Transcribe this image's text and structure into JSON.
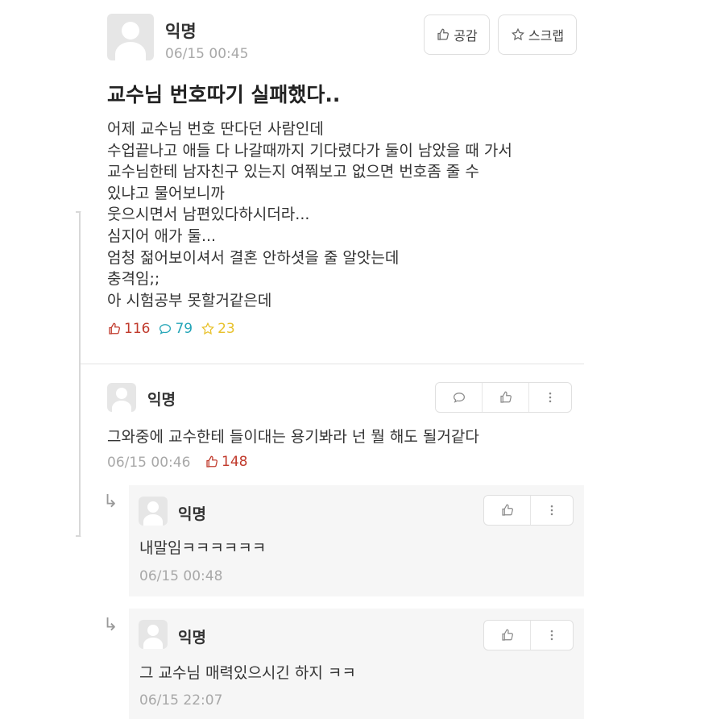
{
  "post": {
    "author": "익명",
    "time": "06/15 00:45",
    "like_label": "공감",
    "scrap_label": "스크랩",
    "title": "교수님 번호따기 실패했다..",
    "lines": [
      "어제 교수님 번호 딴다던 사람인데",
      "수업끝나고 애들 다 나갈때까지 기다렸다가 둘이 남았을 때 가서",
      "교수님한테 남자친구 있는지 여쭤보고 없으면 번호좀 줄 수",
      "있냐고 물어보니까",
      "웃으시면서 남편있다하시더라...",
      "심지어 애가 둘...",
      "엄청 젊어보이셔서 결혼 안하셧을 줄 알앗는데",
      "충격임;;",
      "아 시험공부 못할거같은데"
    ],
    "likes": "116",
    "comments": "79",
    "scraps": "23"
  },
  "comment": {
    "author": "익명",
    "text": "그와중에 교수한테 들이대는 용기봐라 넌 뭘 해도 될거같다",
    "time": "06/15 00:46",
    "likes": "148"
  },
  "replies": [
    {
      "author": "익명",
      "text": "내말임ㅋㅋㅋㅋㅋㅋ",
      "time": "06/15 00:48"
    },
    {
      "author": "익명",
      "text": "그 교수님 매력있으시긴 하지 ㅋㅋ",
      "time": "06/15 22:07"
    }
  ],
  "colors": {
    "like": "#c0392b",
    "comment": "#26a6b8",
    "scrap": "#e8c12b"
  },
  "icons": [
    "thumb-up-icon",
    "star-icon",
    "speech-bubble-icon",
    "more-vertical-icon",
    "reply-arrow-icon"
  ]
}
